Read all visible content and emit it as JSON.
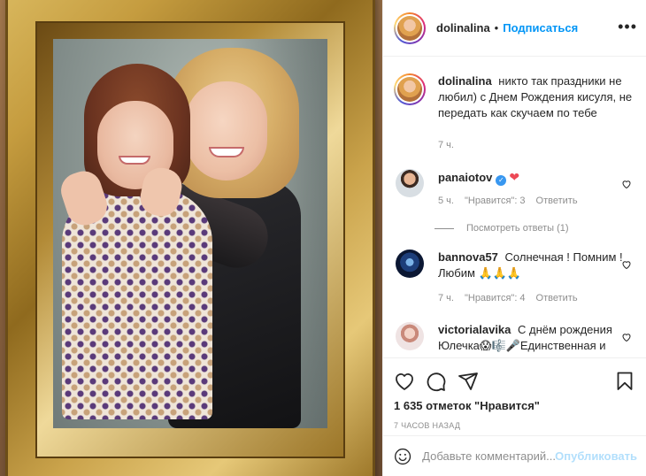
{
  "header": {
    "username": "dolinalina",
    "separator": "•",
    "follow_label": "Подписаться",
    "more_label": "•••"
  },
  "caption": {
    "username": "dolinalina",
    "text": "никто так праздники не любил) с Днем Рождения кисуля, не передать как скучаем по тебе",
    "time": "7 ч."
  },
  "comments": [
    {
      "username": "panaiotov",
      "text": "❤",
      "verified": true,
      "time": "5 ч.",
      "likes": "\"Нравится\": 3",
      "reply": "Ответить",
      "view_replies": "Посмотреть ответы (1)"
    },
    {
      "username": "bannova57",
      "text": "Солнечная ! Помним ! Любим 🙏🙏🙏",
      "time": "7 ч.",
      "likes": "\"Нравится\": 4",
      "reply": "Ответить"
    },
    {
      "username": "victorialavika",
      "text": "С днём рождения Юлечка😱🎼🎤Единственная и неповторимая принцесса"
    }
  ],
  "actions": {
    "like_count": "1 635 отметок \"Нравится\"",
    "time_ago": "7 часов назад"
  },
  "add_comment": {
    "placeholder": "Добавьте комментарий...",
    "publish_label": "Опубликовать"
  },
  "icons": {
    "like": "heart-outline-icon",
    "comment": "comment-bubble-icon",
    "share": "paper-plane-icon",
    "save": "bookmark-icon",
    "emoji": "smiley-icon"
  },
  "colors": {
    "link_blue": "#0095f6",
    "publish_disabled": "#b2dffc",
    "heart_red": "#ed4956",
    "muted": "#8e8e8e"
  }
}
